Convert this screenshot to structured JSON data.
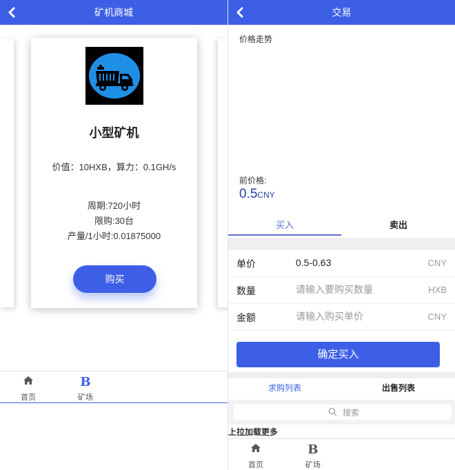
{
  "left": {
    "title": "矿机商城",
    "card": {
      "name": "小型矿机",
      "value_line": "价值：10HXB，算力：0.1GH/s",
      "period": "周期:720小时",
      "limit": "限购:30台",
      "output": "产量/1小时:0.01875000",
      "buy_label": "购买"
    },
    "tabbar": {
      "home": "首页",
      "mine": "矿场",
      "mine_glyph": "B"
    }
  },
  "right": {
    "title": "交易",
    "price_trend_label": "价格走势",
    "current_price_label": "前价格:",
    "current_price": "0.5",
    "current_price_unit": "CNY",
    "trade_tabs": [
      "买入",
      "卖出"
    ],
    "form": {
      "price_label": "单价",
      "price_value": "0.5-0.63",
      "price_unit": "CNY",
      "qty_label": "数量",
      "qty_placeholder": "请输入要购买数量",
      "qty_unit": "HXB",
      "amount_label": "金额",
      "amount_placeholder": "请输入购买单价",
      "amount_unit": "CNY"
    },
    "confirm_label": "确定买入",
    "list_tabs": [
      "求购列表",
      "出售列表"
    ],
    "search_placeholder": "搜索",
    "load_more": "上拉加载更多",
    "tabbar": {
      "home": "首页",
      "mine": "矿场",
      "mine_glyph": "B"
    }
  },
  "colors": {
    "accent": "#3d5fe6",
    "price_text": "#2a3fa5",
    "truck_circle": "#1f8fe6"
  },
  "icons": [
    "back-arrow-icon",
    "dump-truck-icon",
    "home-icon",
    "b-letter-icon",
    "search-icon"
  ]
}
